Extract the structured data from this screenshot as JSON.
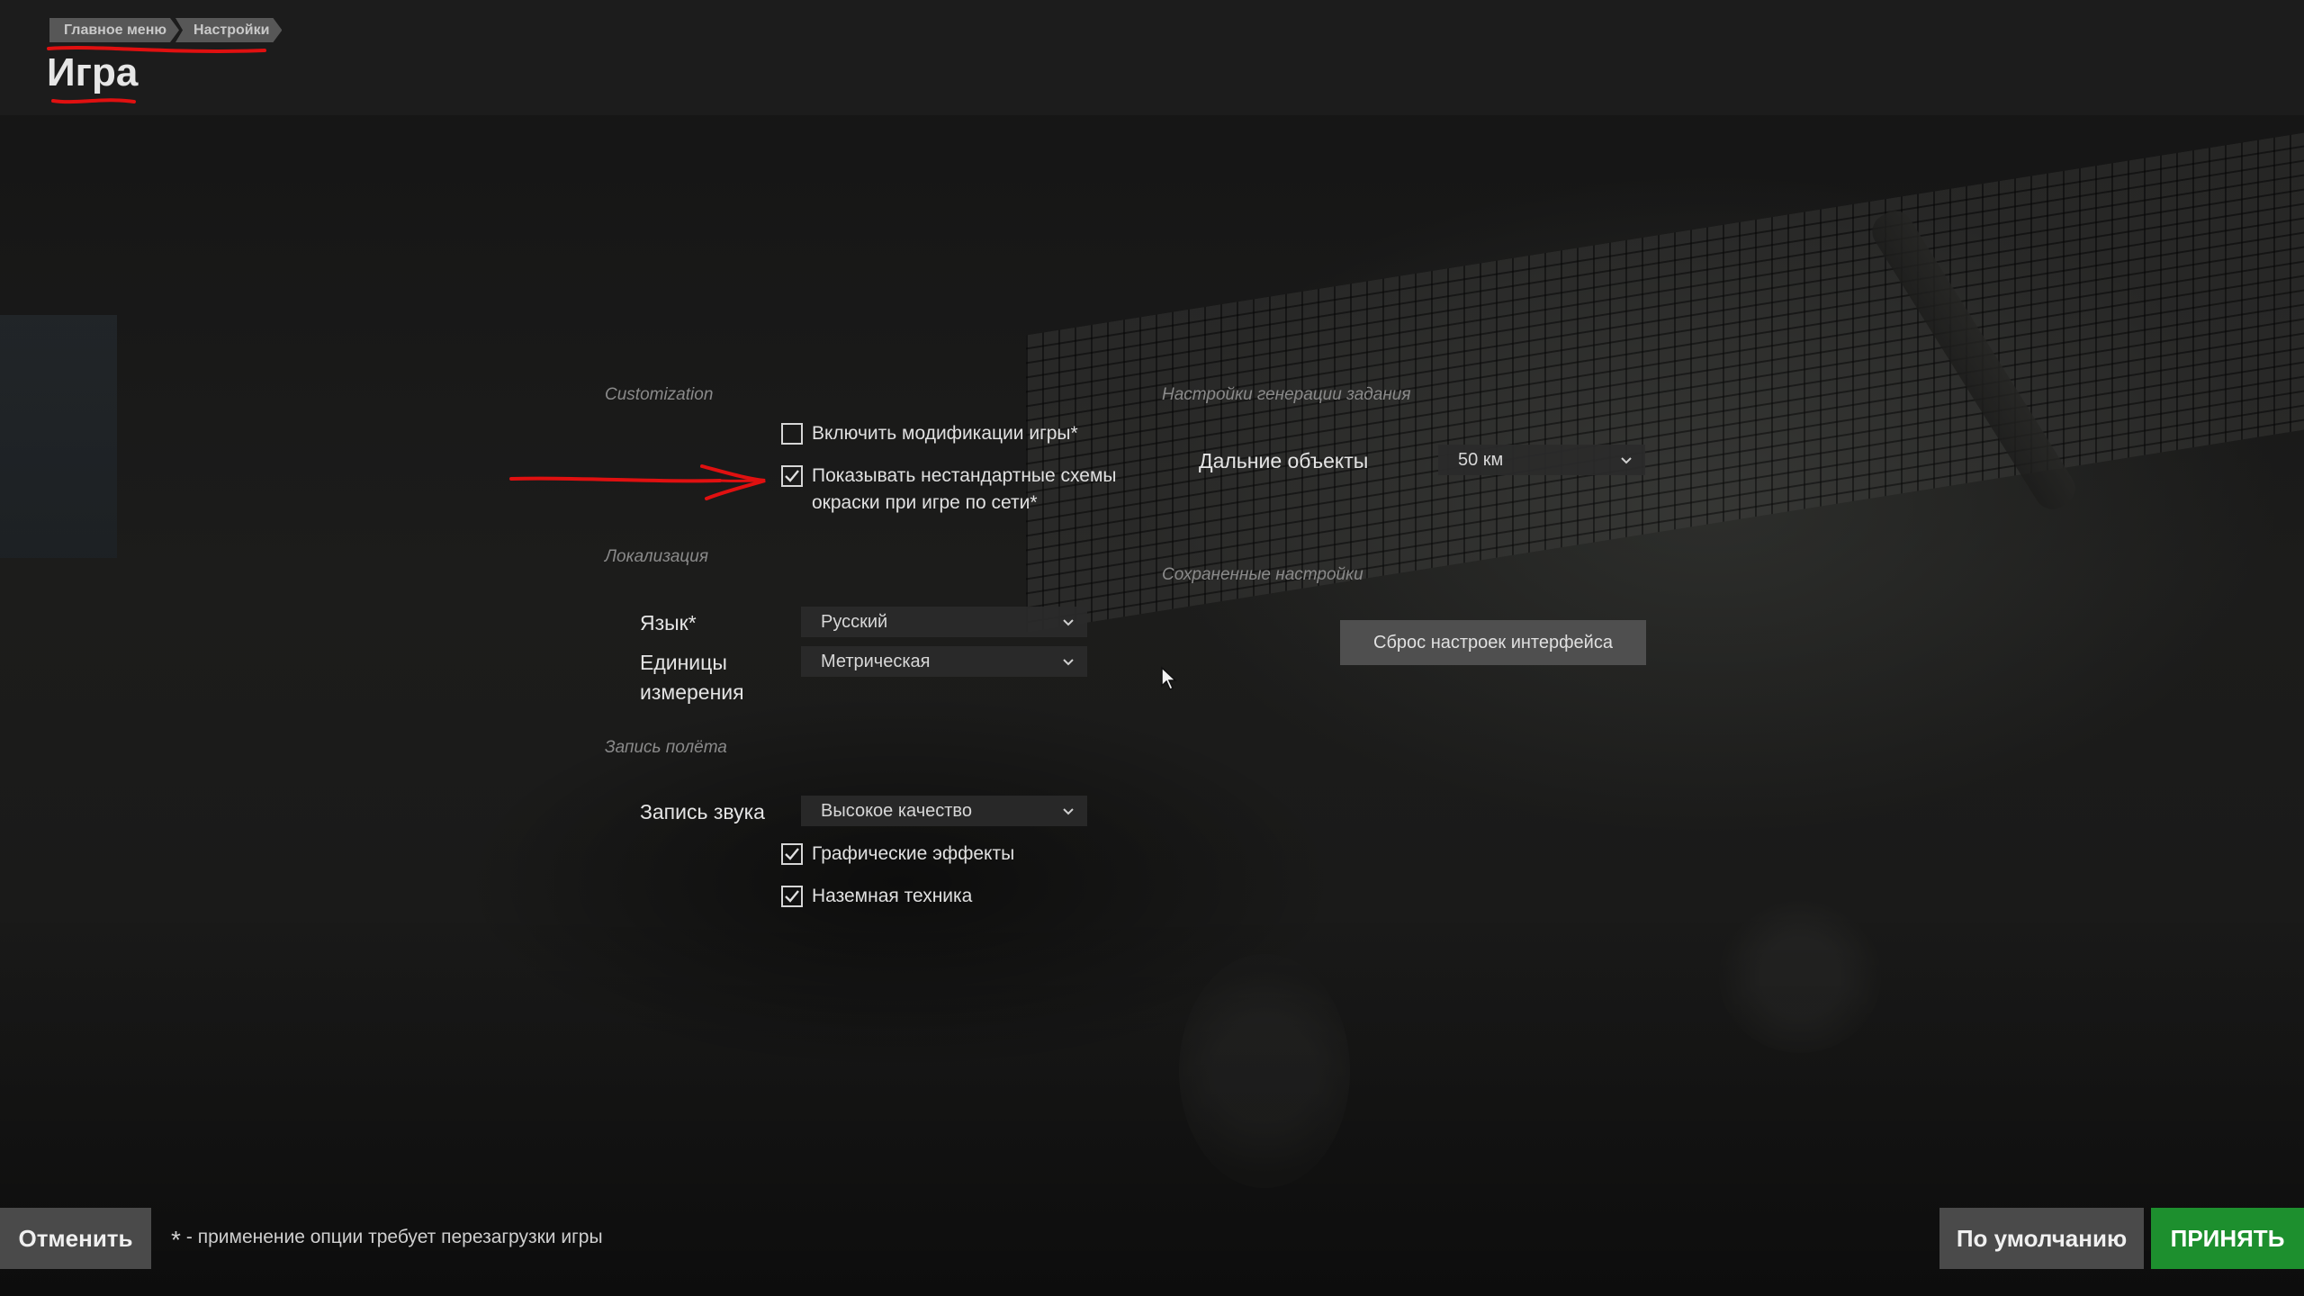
{
  "header": {
    "breadcrumbs": [
      "Главное меню",
      "Настройки"
    ],
    "title": "Игра"
  },
  "customization": {
    "section_label": "Customization",
    "enable_mods": {
      "label": "Включить модификации игры*",
      "checked": false
    },
    "show_custom_skins": {
      "line1": "Показывать нестандартные схемы",
      "line2": "окраски при игре по сети*",
      "checked": true
    }
  },
  "localization": {
    "section_label": "Локализация",
    "language": {
      "label": "Язык*",
      "value": "Русский"
    },
    "units": {
      "label_line1": "Единицы",
      "label_line2": "измерения",
      "value": "Метрическая"
    }
  },
  "flight_recording": {
    "section_label": "Запись полёта",
    "sound": {
      "label": "Запись звука",
      "value": "Высокое качество"
    },
    "graphic_effects": {
      "label": "Графические эффекты",
      "checked": true
    },
    "ground_vehicles": {
      "label": "Наземная техника",
      "checked": true
    }
  },
  "mission_generation": {
    "section_label": "Настройки генерации задания",
    "distant_objects": {
      "label": "Дальние объекты",
      "value": "50 км"
    }
  },
  "saved_settings": {
    "section_label": "Сохраненные настройки",
    "reset_button": "Сброс настроек интерфейса"
  },
  "footer": {
    "cancel": "Отменить",
    "note_star": "*",
    "note": "- применение опции требует перезагрузки игры",
    "defaults": "По умолчанию",
    "accept": "ПРИНЯТЬ"
  },
  "colors": {
    "accept_green": "#1d8f2e",
    "annotation_red": "#e01010"
  },
  "icons": [
    "checkmark-icon",
    "chevron-down-icon",
    "mouse-cursor-icon"
  ]
}
